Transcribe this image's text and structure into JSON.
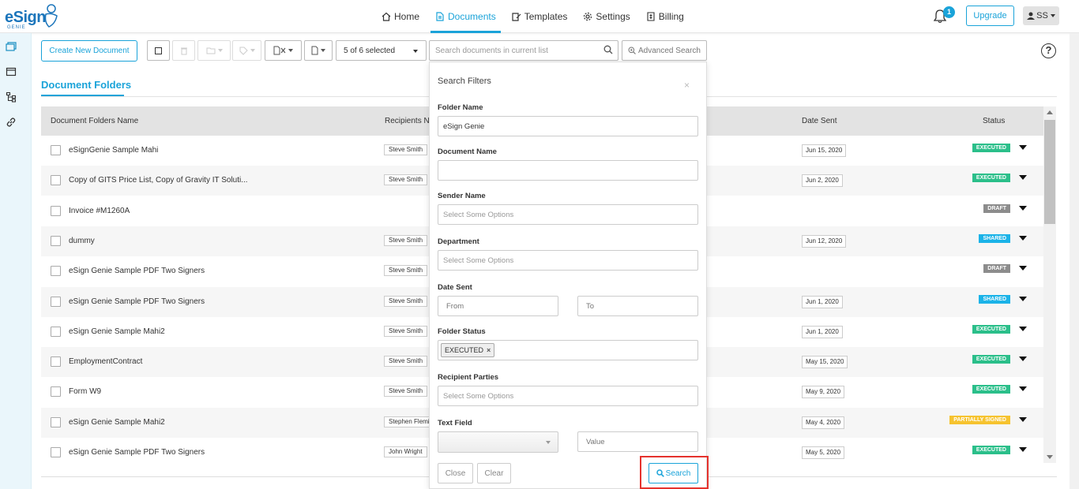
{
  "logo": {
    "word": "eSign",
    "sub": "GENIE"
  },
  "nav": [
    {
      "label": "Home",
      "icon": "home-icon",
      "active": false
    },
    {
      "label": "Documents",
      "icon": "document-icon",
      "active": true
    },
    {
      "label": "Templates",
      "icon": "template-icon",
      "active": false
    },
    {
      "label": "Settings",
      "icon": "gear-icon",
      "active": false
    },
    {
      "label": "Billing",
      "icon": "billing-icon",
      "active": false
    }
  ],
  "header": {
    "notifications": "1",
    "upgrade": "Upgrade",
    "user": "SS"
  },
  "toolbar": {
    "create": "Create New Document",
    "selected": "5 of 6 selected",
    "search_placeholder": "Search documents in current list",
    "advanced": "Advanced Search"
  },
  "tab": {
    "folders": "Document Folders"
  },
  "table": {
    "headers": {
      "name": "Document Folders Name",
      "recipients": "Recipients Na",
      "date": "Date Sent",
      "status": "Status"
    },
    "rows": [
      {
        "name": "eSignGenie Sample Mahi",
        "recipient": "Steve Smith",
        "date": "Jun 15, 2020",
        "status": "EXECUTED"
      },
      {
        "name": "Copy of GITS Price List, Copy of Gravity IT Soluti...",
        "recipient": "Steve Smith",
        "date": "Jun 2, 2020",
        "status": "EXECUTED"
      },
      {
        "name": "Invoice #M1260A",
        "recipient": "",
        "date": "",
        "status": "DRAFT"
      },
      {
        "name": "dummy",
        "recipient": "Steve Smith",
        "date": "Jun 12, 2020",
        "status": "SHARED"
      },
      {
        "name": "eSign Genie Sample PDF Two Signers",
        "recipient": "Steve Smith",
        "date": "",
        "status": "DRAFT"
      },
      {
        "name": "eSign Genie Sample PDF Two Signers",
        "recipient": "Steve Smith",
        "date": "Jun 1, 2020",
        "status": "SHARED"
      },
      {
        "name": "eSign Genie Sample Mahi2",
        "recipient": "Steve Smith",
        "date": "Jun 1, 2020",
        "status": "EXECUTED"
      },
      {
        "name": "EmploymentContract",
        "recipient": "Steve Smith",
        "date": "May 15, 2020",
        "status": "EXECUTED"
      },
      {
        "name": "Form W9",
        "recipient": "Steve Smith",
        "date": "May 9, 2020",
        "status": "EXECUTED"
      },
      {
        "name": "eSign Genie Sample Mahi2",
        "recipient": "Stephen Flemi",
        "date": "May 4, 2020",
        "status": "PARTIALLY SIGNED"
      },
      {
        "name": "eSign Genie Sample PDF Two Signers",
        "recipient": "John Wright",
        "date": "May 5, 2020",
        "status": "EXECUTED"
      }
    ]
  },
  "status_colors": {
    "EXECUTED": "#2bbf8a",
    "DRAFT": "#8c8c8c",
    "SHARED": "#1bb3e8",
    "PARTIALLY SIGNED": "#f6c32f"
  },
  "filter": {
    "title": "Search Filters",
    "close": "×",
    "folder_name_label": "Folder Name",
    "folder_name_value": "eSign Genie",
    "document_name_label": "Document Name",
    "sender_name_label": "Sender Name",
    "sender_name_placeholder": "Select Some Options",
    "department_label": "Department",
    "department_placeholder": "Select Some Options",
    "date_sent_label": "Date Sent",
    "from_placeholder": "From",
    "to_placeholder": "To",
    "folder_status_label": "Folder Status",
    "folder_status_tag": "EXECUTED",
    "recipient_parties_label": "Recipient Parties",
    "recipient_parties_placeholder": "Select Some Options",
    "text_field_label": "Text Field",
    "value_placeholder": "Value",
    "close_btn": "Close",
    "clear_btn": "Clear",
    "search_btn": "Search"
  },
  "colors": {
    "accent": "#1aa3d9",
    "highlight": "#e5322d"
  }
}
